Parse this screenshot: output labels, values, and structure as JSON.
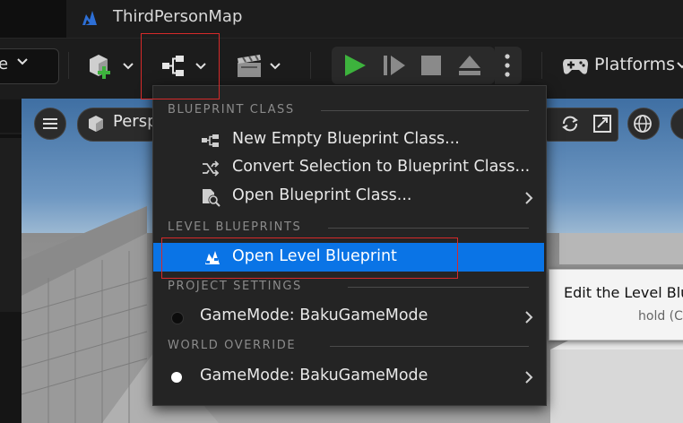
{
  "window": {
    "tab_title": "ThirdPersonMap"
  },
  "toolbar": {
    "mode_label": "e",
    "platforms_label": "Platforms"
  },
  "viewport": {
    "perspective_label": "Persp"
  },
  "blueprint_menu": {
    "sections": [
      {
        "title": "BLUEPRINT CLASS",
        "items": [
          {
            "label": "New Empty Blueprint Class...",
            "icon": "blueprint-graph-icon"
          },
          {
            "label": "Convert Selection to Blueprint Class...",
            "icon": "shuffle-icon"
          },
          {
            "label": "Open Blueprint Class...",
            "icon": "open-blueprint-icon",
            "submenu": true
          }
        ]
      },
      {
        "title": "LEVEL BLUEPRINTS",
        "items": [
          {
            "label": "Open Level Blueprint",
            "icon": "level-blueprint-icon",
            "selected": true
          }
        ]
      },
      {
        "title": "PROJECT SETTINGS",
        "items": [
          {
            "label": "GameMode: BakuGameMode",
            "icon": "black-dot-icon",
            "submenu": true
          }
        ]
      },
      {
        "title": "WORLD OVERRIDE",
        "items": [
          {
            "label": "GameMode: BakuGameMode",
            "icon": "white-dot-icon",
            "submenu": true
          }
        ]
      }
    ]
  },
  "tooltip": {
    "main": "Edit the Level Blu",
    "sub": "hold (C"
  },
  "colors": {
    "selection": "#0a74e6",
    "highlight_box": "#d62a2a",
    "play_green": "#3db33d",
    "menu_bg": "#242424"
  }
}
